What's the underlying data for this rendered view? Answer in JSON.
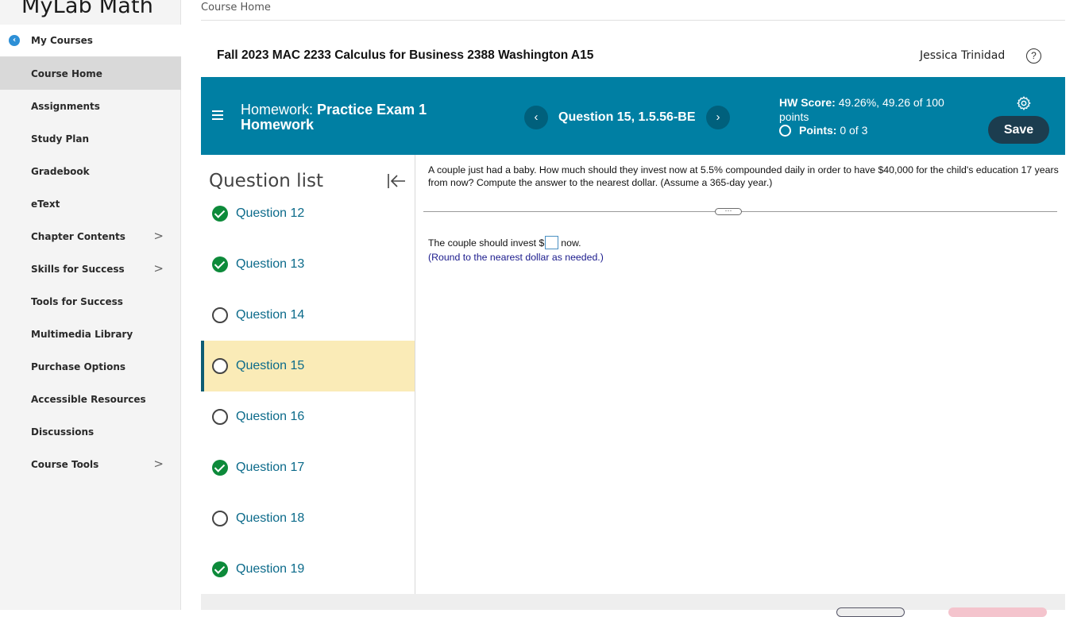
{
  "app": {
    "logo": "MyLab Math",
    "breadcrumb": "Course Home"
  },
  "sidebar": {
    "back_icon": "chevron-left-icon",
    "items": [
      {
        "label": "My Courses",
        "has_chevron": false
      },
      {
        "label": "Course Home",
        "has_chevron": false,
        "active": true
      },
      {
        "label": "Assignments",
        "has_chevron": false
      },
      {
        "label": "Study Plan",
        "has_chevron": false
      },
      {
        "label": "Gradebook",
        "has_chevron": false
      },
      {
        "label": "eText",
        "has_chevron": false
      },
      {
        "label": "Chapter Contents",
        "has_chevron": true
      },
      {
        "label": "Skills for Success",
        "has_chevron": true
      },
      {
        "label": "Tools for Success",
        "has_chevron": false
      },
      {
        "label": "Multimedia Library",
        "has_chevron": false
      },
      {
        "label": "Purchase Options",
        "has_chevron": false
      },
      {
        "label": "Accessible Resources",
        "has_chevron": false
      },
      {
        "label": "Discussions",
        "has_chevron": false
      },
      {
        "label": "Course Tools",
        "has_chevron": true
      }
    ]
  },
  "header": {
    "course_title": "Fall 2023 MAC 2233 Calculus for Business 2388 Washington A15",
    "user_name": "Jessica Trinidad",
    "help_icon": "?"
  },
  "homework": {
    "prefix": "Homework:",
    "title": "Practice Exam 1 Homework",
    "question_label": "Question 15, 1.5.56-BE",
    "score_label": "HW Score:",
    "score_value": "49.26%, 49.26 of 100 points",
    "points_label": "Points:",
    "points_value": "0 of 3",
    "save_label": "Save",
    "colors": {
      "bar": "#007fa3",
      "save": "#1c3d4f",
      "current_row": "#faebb7",
      "done": "#0d8a3a"
    }
  },
  "question_list": {
    "heading": "Question list",
    "items": [
      {
        "label": "Question 12",
        "status": "done"
      },
      {
        "label": "Question 13",
        "status": "done"
      },
      {
        "label": "Question 14",
        "status": "open"
      },
      {
        "label": "Question 15",
        "status": "open",
        "current": true
      },
      {
        "label": "Question 16",
        "status": "open"
      },
      {
        "label": "Question 17",
        "status": "done"
      },
      {
        "label": "Question 18",
        "status": "open"
      },
      {
        "label": "Question 19",
        "status": "done"
      }
    ]
  },
  "question": {
    "text": "A couple just had a baby. How much should they invest now at 5.5% compounded daily in order to have $40,000 for the child's education 17 years from now? Compute the answer to the nearest dollar. (Assume a 365-day year.)",
    "answer_prefix": "The couple should invest $",
    "answer_value": "",
    "answer_suffix": "now.",
    "hint": "(Round to the nearest dollar as needed.)",
    "divider_handle": "···"
  }
}
